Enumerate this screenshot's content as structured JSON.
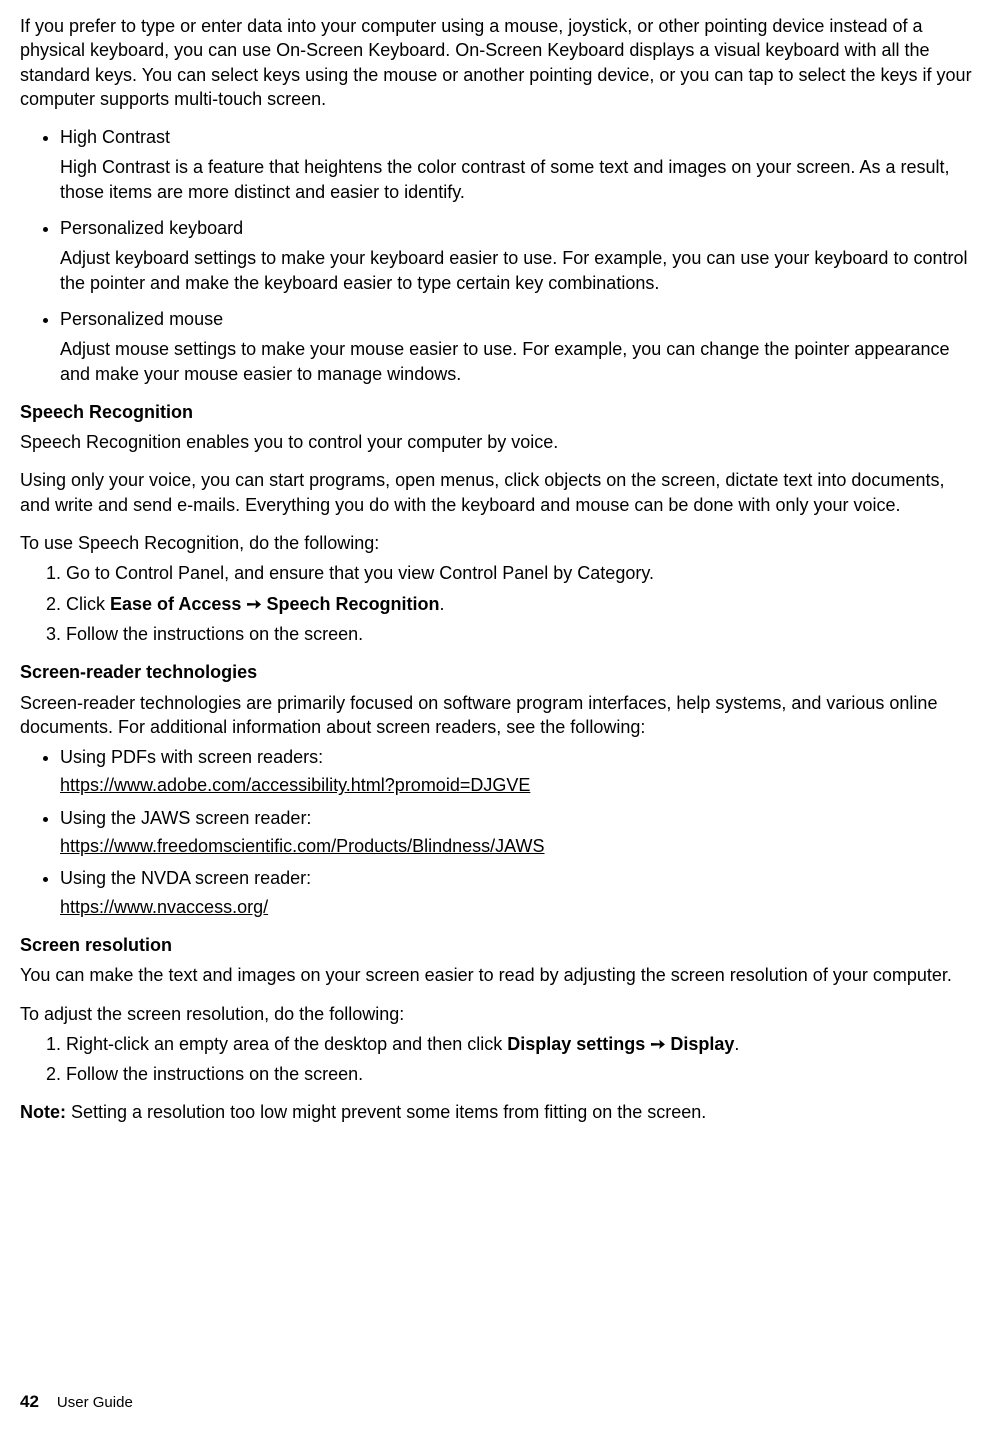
{
  "intro_paragraph": "If you prefer to type or enter data into your computer using a mouse, joystick, or other pointing device instead of a physical keyboard, you can use On-Screen Keyboard. On-Screen Keyboard displays a visual keyboard with all the standard keys. You can select keys using the mouse or another pointing device, or you can tap to select the keys if your computer supports multi-touch screen.",
  "bullets": [
    {
      "title": "High Contrast",
      "body": "High Contrast is a feature that heightens the color contrast of some text and images on your screen. As a result, those items are more distinct and easier to identify."
    },
    {
      "title": "Personalized keyboard",
      "body": "Adjust keyboard settings to make your keyboard easier to use. For example, you can use your keyboard to control the pointer and make the keyboard easier to type certain key combinations."
    },
    {
      "title": "Personalized mouse",
      "body": "Adjust mouse settings to make your mouse easier to use. For example, you can change the pointer appearance and make your mouse easier to manage windows."
    }
  ],
  "speech": {
    "heading": "Speech Recognition",
    "p1": "Speech Recognition enables you to control your computer by voice.",
    "p2": "Using only your voice, you can start programs, open menus, click objects on the screen, dictate text into documents, and write and send e-mails. Everything you do with the keyboard and mouse can be done with only your voice.",
    "p3": "To use Speech Recognition, do the following:",
    "steps": {
      "s1": "Go to Control Panel, and ensure that you view Control Panel by Category.",
      "s2_pre": "Click ",
      "s2_bold1": "Ease of Access",
      "s2_arrow": " ➙ ",
      "s2_bold2": "Speech Recognition",
      "s2_post": ".",
      "s3": "Follow the instructions on the screen."
    }
  },
  "reader": {
    "heading": "Screen-reader technologies",
    "p1": "Screen-reader technologies are primarily focused on software program interfaces, help systems, and various online documents. For additional information about screen readers, see the following:",
    "items": [
      {
        "label": "Using PDFs with screen readers:",
        "url": "https://www.adobe.com/accessibility.html?promoid=DJGVE"
      },
      {
        "label": "Using the JAWS screen reader:",
        "url": "https://www.freedomscientific.com/Products/Blindness/JAWS"
      },
      {
        "label": "Using the NVDA screen reader:",
        "url": "https://www.nvaccess.org/"
      }
    ]
  },
  "resolution": {
    "heading": "Screen resolution",
    "p1": "You can make the text and images on your screen easier to read by adjusting the screen resolution of your computer.",
    "p2": "To adjust the screen resolution, do the following:",
    "steps": {
      "s1_pre": "Right-click an empty area of the desktop and then click ",
      "s1_bold1": "Display settings",
      "s1_arrow": " ➙ ",
      "s1_bold2": "Display",
      "s1_post": ".",
      "s2": "Follow the instructions on the screen."
    },
    "note_label": "Note:  ",
    "note_body": "Setting a resolution too low might prevent some items from fitting on the screen."
  },
  "footer": {
    "page_number": "42",
    "doc_title": "User Guide"
  }
}
